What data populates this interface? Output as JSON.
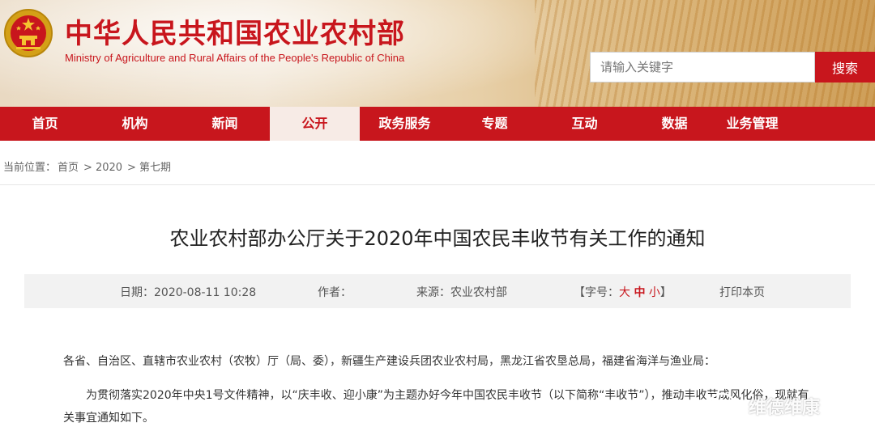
{
  "header": {
    "title": "中华人民共和国农业农村部",
    "subtitle": "Ministry of Agriculture and Rural Affairs of the People's Republic of China",
    "search_placeholder": "请输入关键字",
    "search_button": "搜索"
  },
  "nav": {
    "items": [
      {
        "label": "首页"
      },
      {
        "label": "机构"
      },
      {
        "label": "新闻"
      },
      {
        "label": "公开",
        "active": true
      },
      {
        "label": "政务服务"
      },
      {
        "label": "专题"
      },
      {
        "label": "互动"
      },
      {
        "label": "数据"
      },
      {
        "label": "业务管理"
      }
    ]
  },
  "breadcrumb": {
    "prefix": "当前位置：",
    "items": [
      "首页",
      "2020",
      "第七期"
    ],
    "separator": ">"
  },
  "article": {
    "title": "农业农村部办公厅关于2020年中国农民丰收节有关工作的通知",
    "meta": {
      "date_label": "日期：",
      "date_value": "2020-08-11 10:28",
      "author_label": "作者：",
      "source_label": "来源：",
      "source_value": "农业农村部",
      "font_open": "【字号：",
      "font_large": "大",
      "font_medium": "中",
      "font_small": "小",
      "font_close": "】",
      "print_label": "打印本页"
    },
    "paragraphs": [
      "各省、自治区、直辖市农业农村（农牧）厅（局、委），新疆生产建设兵团农业农村局，黑龙江省农垦总局，福建省海洋与渔业局：",
      "为贯彻落实2020年中央1号文件精神，以“庆丰收、迎小康”为主题办好今年中国农民丰收节（以下简称“丰收节”），推动丰收节成风化俗，现就有关事宜通知如下。"
    ]
  },
  "watermark": {
    "text": "维德维康",
    "icon": "wechat-icon"
  },
  "colors": {
    "brand_red": "#c8161d",
    "nav_active_bg": "#f7ebe6",
    "meta_bg": "#f2f2f2"
  }
}
